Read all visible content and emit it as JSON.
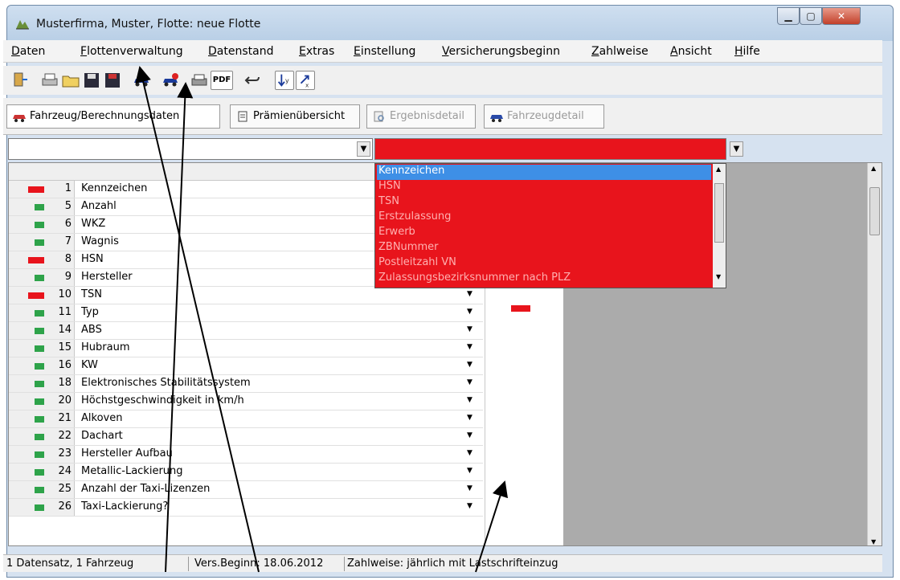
{
  "window": {
    "title": "Musterfirma, Muster, Flotte: neue Flotte",
    "controls": [
      "minimize-icon",
      "maximize-icon",
      "close-icon"
    ]
  },
  "menu": [
    "Daten",
    "Flottenverwaltung",
    "Datenstand",
    "Extras",
    "Einstellung",
    "Versicherungsbeginn",
    "Zahlweise",
    "Ansicht",
    "Hilfe"
  ],
  "tabs": [
    {
      "label": "Fahrzeug/Berechnungsdaten",
      "enabled": true
    },
    {
      "label": "Prämienübersicht",
      "enabled": true
    },
    {
      "label": "Ergebnisdetail",
      "enabled": false
    },
    {
      "label": "Fahrzeugdetail",
      "enabled": false
    }
  ],
  "toolbar": {
    "icons": [
      "exit-icon",
      "print-icon",
      "open-folder-icon",
      "save-icon",
      "save-as-icon",
      "car-icon",
      "car-red-icon",
      "printer-icon",
      "pdf-icon",
      "undo-icon",
      "sort-icon",
      "function-icon"
    ],
    "pdf_label": "PDF"
  },
  "combos": {
    "left_value": "",
    "right_value": ""
  },
  "dropdown": {
    "items": [
      "Kennzeichen",
      "HSN",
      "TSN",
      "Erstzulassung",
      "Erwerb",
      "ZBNummer",
      "Postleitzahl VN",
      "Zulassungsbezirksnummer nach PLZ"
    ],
    "selected": "Kennzeichen"
  },
  "rows": [
    {
      "num": "1",
      "label": "Kennzeichen",
      "status": "red"
    },
    {
      "num": "5",
      "label": "Anzahl",
      "status": "green"
    },
    {
      "num": "6",
      "label": "WKZ",
      "status": "green"
    },
    {
      "num": "7",
      "label": "Wagnis",
      "status": "green"
    },
    {
      "num": "8",
      "label": "HSN",
      "status": "red"
    },
    {
      "num": "9",
      "label": "Hersteller",
      "status": "green"
    },
    {
      "num": "10",
      "label": "TSN",
      "status": "red"
    },
    {
      "num": "11",
      "label": "Typ",
      "status": "green"
    },
    {
      "num": "14",
      "label": "ABS",
      "status": "green"
    },
    {
      "num": "15",
      "label": "Hubraum",
      "status": "green"
    },
    {
      "num": "16",
      "label": "KW",
      "status": "green"
    },
    {
      "num": "18",
      "label": "Elektronisches Stabilitätssystem",
      "status": "green"
    },
    {
      "num": "20",
      "label": "Höchstgeschwindigkeit in km/h",
      "status": "green"
    },
    {
      "num": "21",
      "label": "Alkoven",
      "status": "green"
    },
    {
      "num": "22",
      "label": "Dachart",
      "status": "green"
    },
    {
      "num": "23",
      "label": "Hersteller Aufbau",
      "status": "green"
    },
    {
      "num": "24",
      "label": "Metallic-Lackierung",
      "status": "green"
    },
    {
      "num": "25",
      "label": "Anzahl der Taxi-Lizenzen",
      "status": "green"
    },
    {
      "num": "26",
      "label": "Taxi-Lackierung?",
      "status": "green"
    }
  ],
  "status": {
    "records": "1 Datensatz, 1 Fahrzeug",
    "begin": "Vers.Beginn: 18.06.2012",
    "payment": "Zahlweise: jährlich mit Lastschrifteinzug"
  },
  "colors": {
    "red": "#e8141c",
    "green": "#2ea34a",
    "selection": "#3e8fe6"
  }
}
